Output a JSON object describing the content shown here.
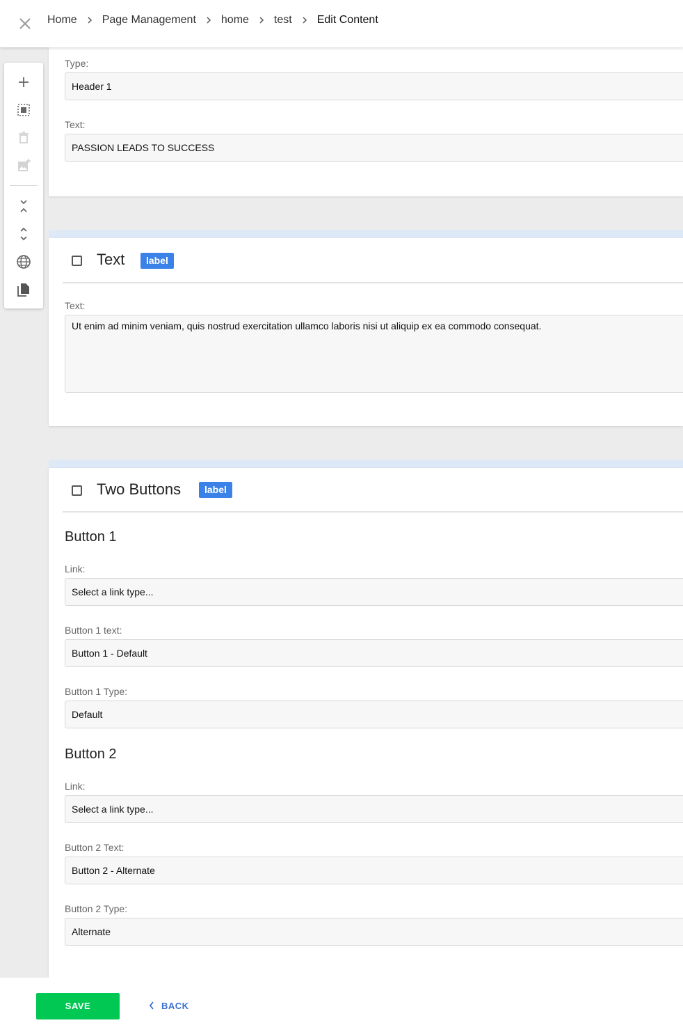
{
  "breadcrumb": [
    "Home",
    "Page Management",
    "home",
    "test",
    "Edit Content"
  ],
  "toolbar_icons": [
    "add-icon",
    "select-all-icon",
    "delete-icon",
    "add-image-icon",
    "collapse-all-icon",
    "expand-all-icon",
    "globe-icon",
    "copy-icon"
  ],
  "header_block": {
    "type_label": "Type:",
    "type_value": "Header 1",
    "text_label": "Text:",
    "text_value": "PASSION LEADS TO SUCCESS"
  },
  "text_block": {
    "title": "Text",
    "tag": "label",
    "text_label": "Text:",
    "text_value": "Ut enim ad minim veniam, quis nostrud exercitation ullamco laboris nisi ut aliquip ex ea commodo consequat."
  },
  "buttons_block": {
    "title": "Two Buttons",
    "tag": "label",
    "button1": {
      "heading": "Button 1",
      "link_label": "Link:",
      "link_value": "Select a link type...",
      "text_label": "Button 1 text:",
      "text_value": "Button 1 - Default",
      "type_label": "Button 1 Type:",
      "type_value": "Default"
    },
    "button2": {
      "heading": "Button 2",
      "link_label": "Link:",
      "link_value": "Select a link type...",
      "text_label": "Button 2 Text:",
      "text_value": "Button 2 - Alternate",
      "type_label": "Button 2 Type:",
      "type_value": "Alternate"
    }
  },
  "footer": {
    "save_label": "SAVE",
    "back_label": "BACK"
  },
  "colors": {
    "save": "#00c853",
    "tag": "#3b82e8",
    "accent": "#dde9f7",
    "back": "#3b6fd1"
  }
}
